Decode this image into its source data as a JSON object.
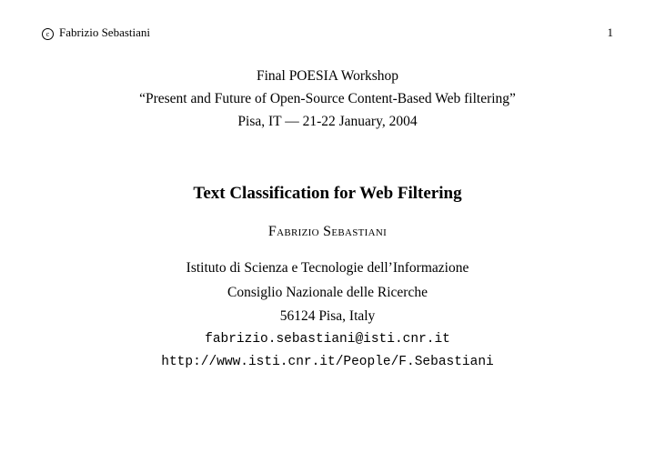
{
  "header": {
    "copyright_mark": "c",
    "author_name": "Fabrizio Sebastiani",
    "page_number": "1"
  },
  "workshop": {
    "line1": "Final POESIA Workshop",
    "line2": "“Present and Future of Open-Source Content-Based Web filtering”",
    "line3": "Pisa, IT — 21-22 January, 2004"
  },
  "title": "Text Classification for Web Filtering",
  "author": "Fabrizio Sebastiani",
  "affiliation": {
    "institute": "Istituto di Scienza e Tecnologie dell’Informazione",
    "org": "Consiglio Nazionale delle Ricerche",
    "address": "56124 Pisa, Italy",
    "email": "fabrizio.sebastiani@isti.cnr.it",
    "url": "http://www.isti.cnr.it/People/F.Sebastiani"
  }
}
